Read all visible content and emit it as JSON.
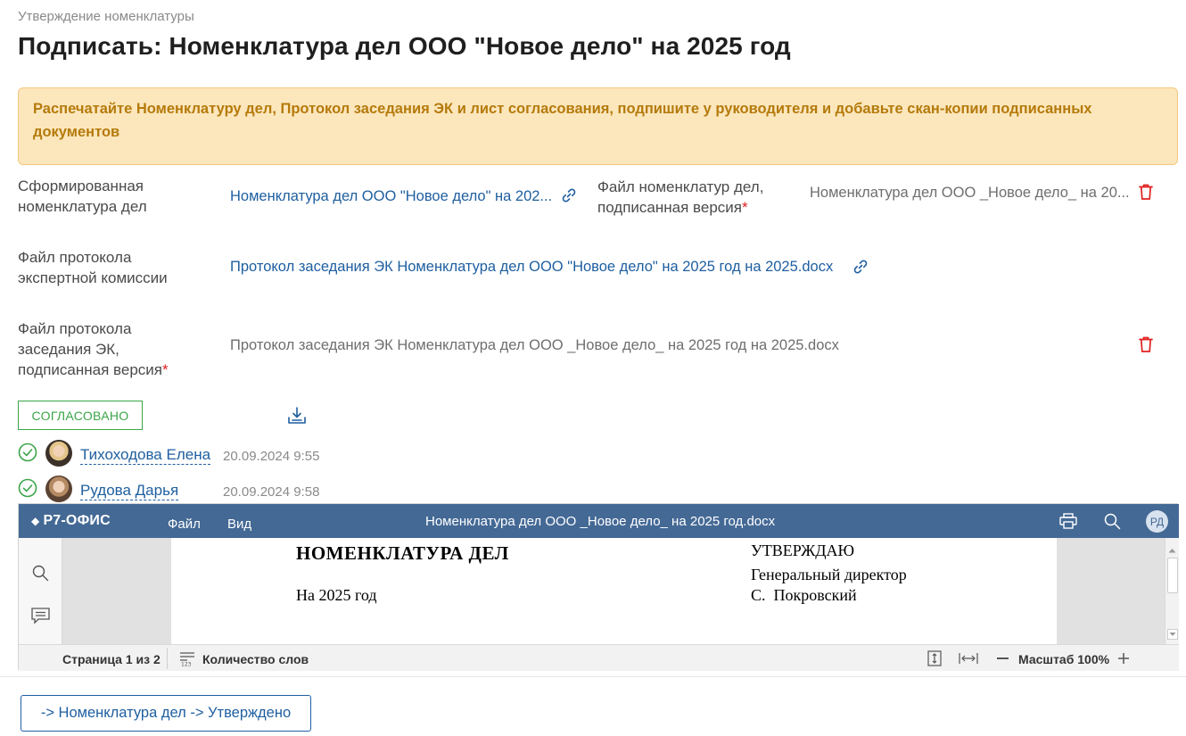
{
  "breadcrumb": "Утверждение номенклатуры",
  "page_title": "Подписать: Номенклатура дел ООО \"Новое дело\" на 2025 год",
  "alert": "Распечатайте Номенклатуру дел, Протокол заседания ЭК и лист согласования, подпишите у руководителя и добавьте скан-копии подписанных документов",
  "fields": {
    "generated": {
      "label": "Сформированная номенклатура дел",
      "value": "Номенклатура дел ООО \"Новое дело\" на 202..."
    },
    "signed_nomenclature": {
      "label": "Файл номенклатур дел, подписанная версия",
      "required_mark": "*",
      "value": "Номенклатура дел ООО _Новое дело_ на 20..."
    },
    "commission_protocol": {
      "label": "Файл протокола экспертной комиссии",
      "value": "Протокол заседания ЭК Номенклатура дел ООО \"Новое дело\" на 2025 год на 2025.docx"
    },
    "signed_protocol": {
      "label": "Файл протокола заседания ЭК, подписанная версия",
      "required_mark": "*",
      "value": "Протокол заседания ЭК Номенклатура дел ООО _Новое дело_ на 2025 год на 2025.docx"
    }
  },
  "status": "СОГЛАСОВАНО",
  "approvers": [
    {
      "name": "Тихоходова Елена",
      "date": "20.09.2024 9:55"
    },
    {
      "name": "Рудова Дарья",
      "date": "20.09.2024 9:58"
    }
  ],
  "editor": {
    "logo": "Р7-ОФИС",
    "menu": [
      "Файл",
      "Вид"
    ],
    "title": "Номенклатура дел ООО _Новое дело_ на 2025 год.docx",
    "user_initials": "РД",
    "doc": {
      "heading": "НОМЕНКЛАТУРА ДЕЛ",
      "year": "На 2025 год",
      "approve": "УТВЕРЖДАЮ",
      "position": "Генеральный директор",
      "signer": "С.  Покровский"
    },
    "status": {
      "page": "Страница 1 из 2",
      "word_count": "Количество слов",
      "zoom": "Масштаб 100%"
    }
  },
  "action_button": "-> Номенклатура дел -> Утверждено",
  "colors": {
    "link": "#1f5fa0",
    "alert_bg": "#fce7bd",
    "alert_text": "#b57a0b",
    "approved": "#3aa548",
    "delete": "#e02020",
    "editor_header": "#446995"
  }
}
